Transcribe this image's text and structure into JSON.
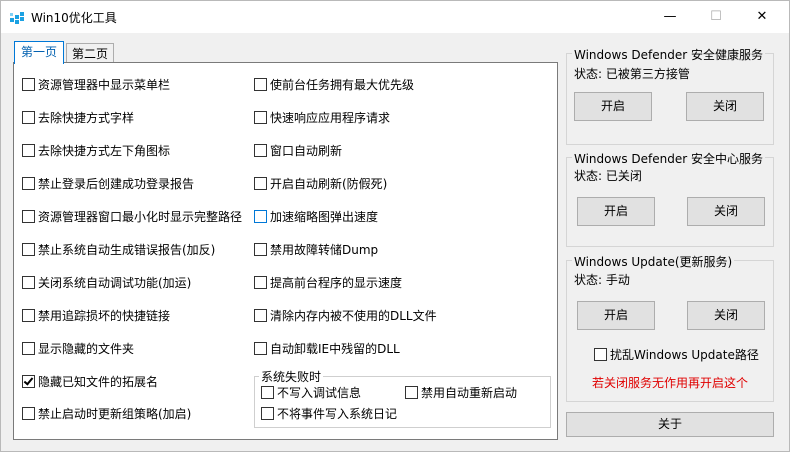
{
  "window": {
    "title": "Win10优化工具",
    "min_glyph": "—",
    "max_glyph": "☐",
    "close_glyph": "✕"
  },
  "tabs": [
    {
      "label": "第一页",
      "active": true
    },
    {
      "label": "第二页",
      "active": false
    }
  ],
  "options_left": [
    {
      "label": "资源管理器中显示菜单栏",
      "checked": false
    },
    {
      "label": "去除快捷方式字样",
      "checked": false
    },
    {
      "label": "去除快捷方式左下角图标",
      "checked": false
    },
    {
      "label": "禁止登录后创建成功登录报告",
      "checked": false
    },
    {
      "label": "资源管理器窗口最小化时显示完整路径",
      "checked": false
    },
    {
      "label": "禁止系统自动生成错误报告(加反)",
      "checked": false
    },
    {
      "label": "关闭系统自动调试功能(加运)",
      "checked": false
    },
    {
      "label": "禁用追踪损坏的快捷链接",
      "checked": false
    },
    {
      "label": "显示隐藏的文件夹",
      "checked": false
    },
    {
      "label": "隐藏已知文件的拓展名",
      "checked": true
    },
    {
      "label": "禁止启动时更新组策略(加启)",
      "checked": false
    }
  ],
  "options_right": [
    {
      "label": "使前台任务拥有最大优先级",
      "checked": false
    },
    {
      "label": "快速响应应用程序请求",
      "checked": false
    },
    {
      "label": "窗口自动刷新",
      "checked": false
    },
    {
      "label": "开启自动刷新(防假死)",
      "checked": false
    },
    {
      "label": "加速缩略图弹出速度",
      "checked": false
    },
    {
      "label": "禁用故障转储Dump",
      "checked": false
    },
    {
      "label": "提高前台程序的显示速度",
      "checked": false
    },
    {
      "label": "清除内存内被不使用的DLL文件",
      "checked": false
    },
    {
      "label": "自动卸载IE中残留的DLL",
      "checked": false
    }
  ],
  "system_failure": {
    "title": "系统失败时",
    "no_debug_info": "不写入调试信息",
    "no_auto_restart": "禁用自动重新启动",
    "no_event_log": "不将事件写入系统日记"
  },
  "services": [
    {
      "title": "Windows Defender 安全健康服务",
      "status": "状态: 已被第三方接管",
      "start": "开启",
      "stop": "关闭"
    },
    {
      "title": "Windows Defender 安全中心服务",
      "status": "状态: 已关闭",
      "start": "开启",
      "stop": "关闭"
    },
    {
      "title": "Windows Update(更新服务)",
      "status": "状态: 手动",
      "start": "开启",
      "stop": "关闭"
    }
  ],
  "update_path_option": "扰乱Windows Update路径",
  "warning": "若关闭服务无作用再开启这个",
  "about_button": "关于",
  "colors": {
    "accent": "#0078d7",
    "warning": "#e00000"
  }
}
